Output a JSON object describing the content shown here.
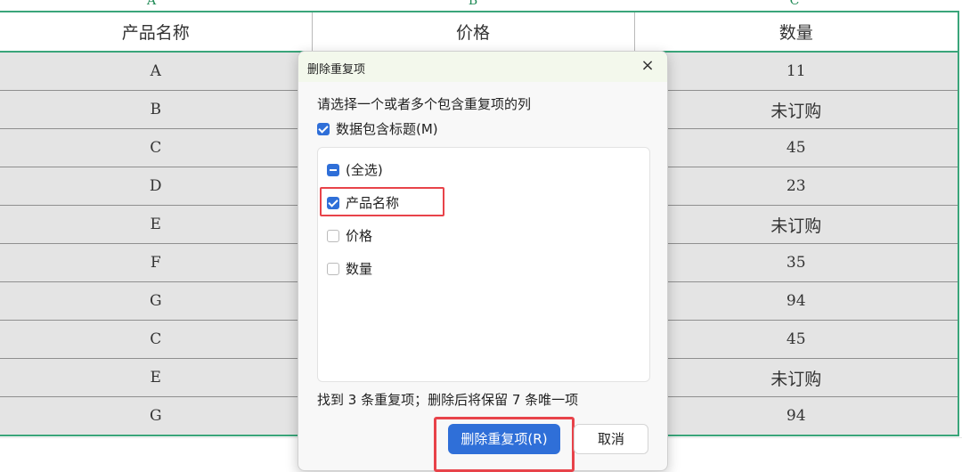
{
  "sheet": {
    "column_letters": [
      "A",
      "B",
      "C"
    ],
    "headers": [
      "产品名称",
      "价格",
      "数量"
    ],
    "rows": [
      [
        "A",
        "",
        "11"
      ],
      [
        "B",
        "",
        "未订购"
      ],
      [
        "C",
        "",
        "45"
      ],
      [
        "D",
        "",
        "23"
      ],
      [
        "E",
        "",
        "未订购"
      ],
      [
        "F",
        "",
        "35"
      ],
      [
        "G",
        "",
        "94"
      ],
      [
        "C",
        "",
        "45"
      ],
      [
        "E",
        "",
        "未订购"
      ],
      [
        "G",
        "",
        "94"
      ]
    ]
  },
  "dialog": {
    "title": "删除重复项",
    "close_glyph": "×",
    "instruction": "请选择一个或者多个包含重复项的列",
    "header_checkbox": {
      "label": "数据包含标题(M)",
      "checked": true
    },
    "columns": [
      {
        "label": "(全选)",
        "state": "partial"
      },
      {
        "label": "产品名称",
        "state": "checked"
      },
      {
        "label": "价格",
        "state": "unchecked"
      },
      {
        "label": "数量",
        "state": "unchecked"
      }
    ],
    "summary": "找到 3 条重复项；删除后将保留 7 条唯一项",
    "confirm_label": "删除重复项(R)",
    "cancel_label": "取消"
  },
  "colors": {
    "accent_green": "#3aa57a",
    "primary_blue": "#2f6fd8",
    "highlight_red": "#e8434a",
    "row_fill": "#e4e4e4"
  }
}
